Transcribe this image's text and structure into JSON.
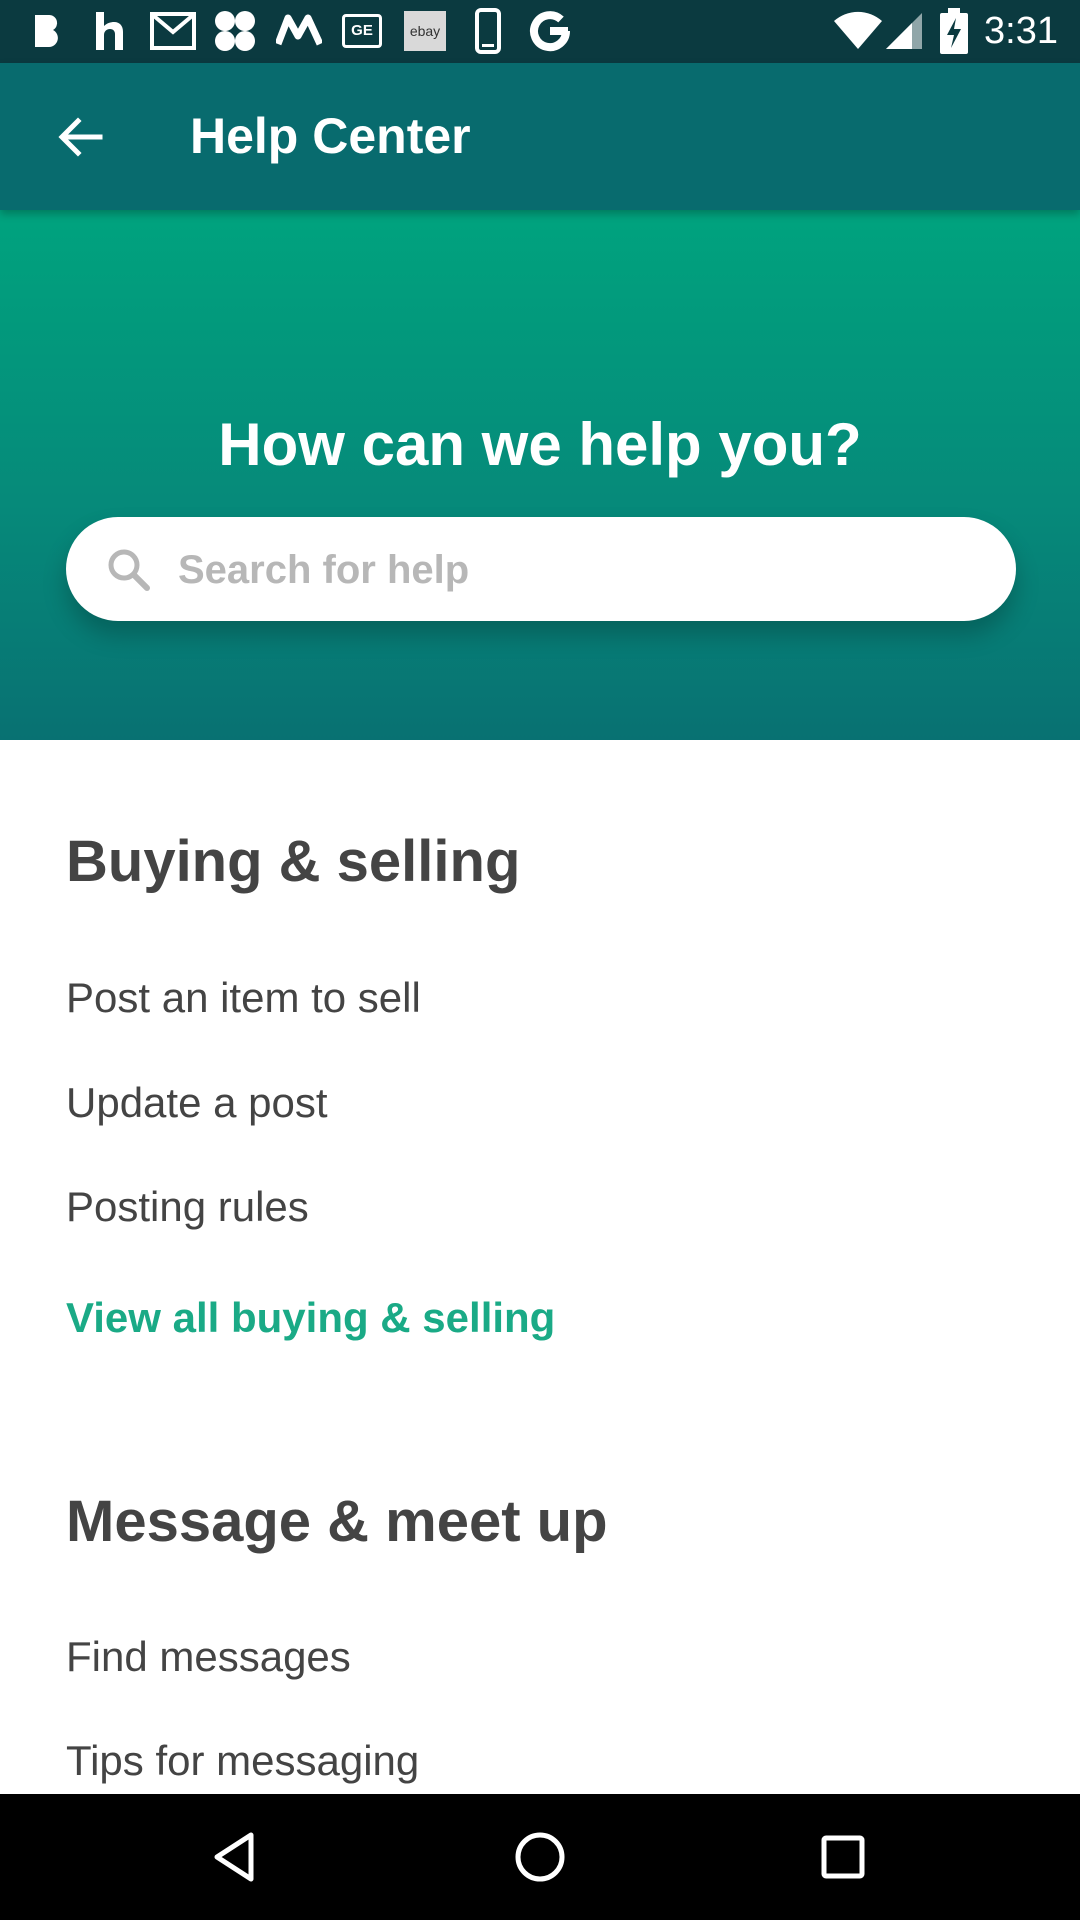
{
  "status_bar": {
    "time": "3:31",
    "notification_icons": [
      "b-app-icon",
      "h-app-icon",
      "gmail-icon",
      "puzzle-app-icon",
      "m-app-icon",
      "ge-app-icon",
      "ebay-icon",
      "phone-icon",
      "google-icon"
    ],
    "ebay_label": "ebay",
    "ge_label": "GE",
    "system_icons": [
      "wifi-icon",
      "signal-icon",
      "battery-charging-icon"
    ]
  },
  "app_bar": {
    "title": "Help Center",
    "back_icon": "arrow-left-icon"
  },
  "hero": {
    "heading": "How can we help you?",
    "search_placeholder": "Search for help",
    "search_value": ""
  },
  "sections": [
    {
      "title": "Buying & selling",
      "items": [
        "Post an item to sell",
        "Update a post",
        "Posting rules"
      ],
      "view_all": "View all buying & selling"
    },
    {
      "title": "Message & meet up",
      "items": [
        "Find messages",
        "Tips for messaging"
      ]
    }
  ],
  "nav_bar": {
    "buttons": [
      "back-triangle-icon",
      "home-circle-icon",
      "recents-square-icon"
    ]
  },
  "colors": {
    "status_bar": "#0b3a40",
    "app_bar": "#086b6e",
    "hero_top": "#00a37e",
    "hero_bottom": "#087172",
    "link": "#1aaa86",
    "text": "#444444"
  }
}
